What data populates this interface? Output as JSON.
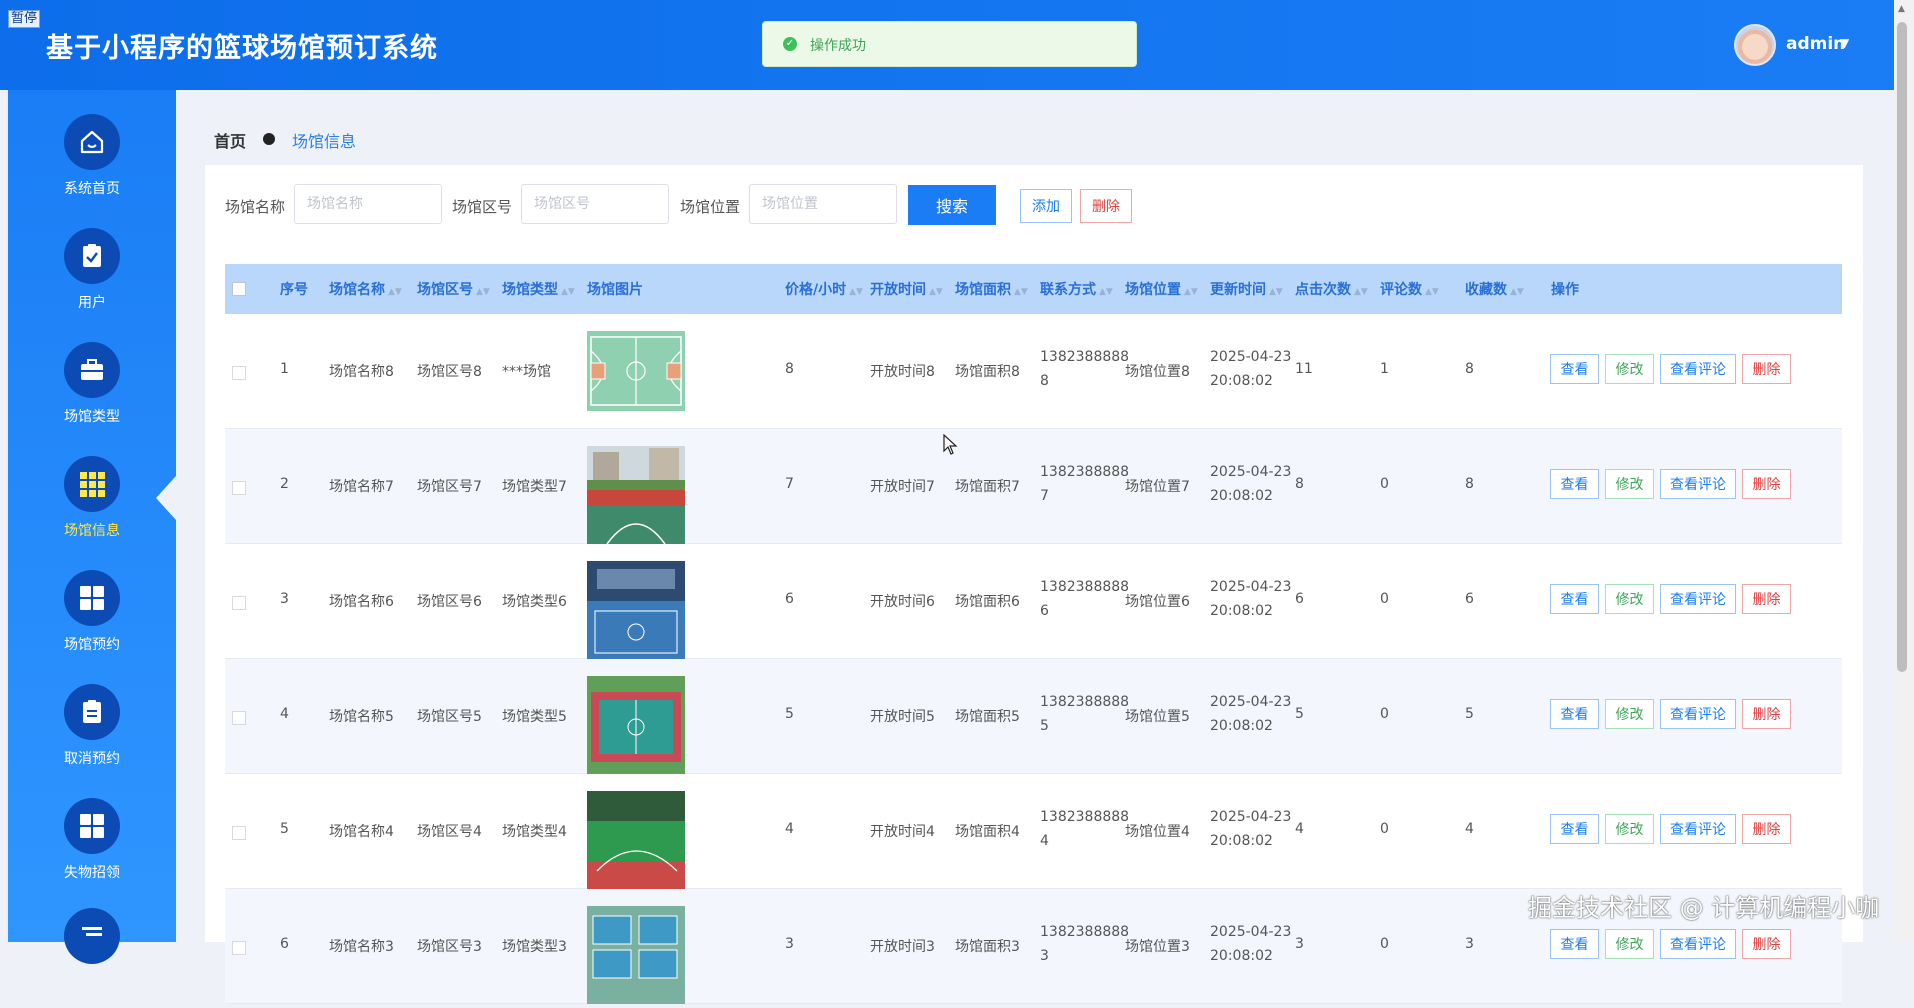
{
  "pause_tag": "暂停",
  "header": {
    "title": "基于小程序的篮球场馆预订系统",
    "user": "admin",
    "caret": "▼"
  },
  "toast": {
    "text": "操作成功",
    "icon": "✓"
  },
  "sidebar": {
    "items": [
      {
        "label": "系统首页",
        "icon": "home-icon"
      },
      {
        "label": "用户",
        "icon": "clipboard-check-icon"
      },
      {
        "label": "场馆类型",
        "icon": "briefcase-icon"
      },
      {
        "label": "场馆信息",
        "icon": "grid-nine-icon",
        "active": true
      },
      {
        "label": "场馆预约",
        "icon": "grid-four-icon"
      },
      {
        "label": "取消预约",
        "icon": "clipboard-icon"
      },
      {
        "label": "失物招领",
        "icon": "grid-four-icon"
      }
    ]
  },
  "breadcrumb": {
    "home": "首页",
    "current": "场馆信息"
  },
  "search": {
    "name_label": "场馆名称",
    "name_placeholder": "场馆名称",
    "zone_label": "场馆区号",
    "zone_placeholder": "场馆区号",
    "location_label": "场馆位置",
    "location_placeholder": "场馆位置",
    "search_button": "搜索",
    "add_button": "添加",
    "delete_button": "删除"
  },
  "table": {
    "columns": [
      "序号",
      "场馆名称",
      "场馆区号",
      "场馆类型",
      "场馆图片",
      "价格/小时",
      "开放时间",
      "场馆面积",
      "联系方式",
      "场馆位置",
      "更新时间",
      "点击次数",
      "评论数",
      "收藏数",
      "操作"
    ],
    "actions": {
      "view": "查看",
      "edit": "修改",
      "comments": "查看评论",
      "delete": "删除"
    },
    "rows": [
      {
        "no": "1",
        "name": "场馆名称8",
        "zone": "场馆区号8",
        "type": "***场馆",
        "price": "8",
        "open": "开放时间8",
        "area": "场馆面积8",
        "phone1": "1382388888",
        "phone2": "8",
        "location": "场馆位置8",
        "date": "2025-04-23",
        "time": "20:08:02",
        "clicks": "11",
        "comments": "1",
        "favorites": "8",
        "image": "court-diagram"
      },
      {
        "no": "2",
        "name": "场馆名称7",
        "zone": "场馆区号7",
        "type": "场馆类型7",
        "price": "7",
        "open": "开放时间7",
        "area": "场馆面积7",
        "phone1": "1382388888",
        "phone2": "7",
        "location": "场馆位置7",
        "date": "2025-04-23",
        "time": "20:08:02",
        "clicks": "8",
        "comments": "0",
        "favorites": "8",
        "image": "outdoor-red-court"
      },
      {
        "no": "3",
        "name": "场馆名称6",
        "zone": "场馆区号6",
        "type": "场馆类型6",
        "price": "6",
        "open": "开放时间6",
        "area": "场馆面积6",
        "phone1": "1382388888",
        "phone2": "6",
        "location": "场馆位置6",
        "date": "2025-04-23",
        "time": "20:08:02",
        "clicks": "6",
        "comments": "0",
        "favorites": "6",
        "image": "indoor-blue-court"
      },
      {
        "no": "4",
        "name": "场馆名称5",
        "zone": "场馆区号5",
        "type": "场馆类型5",
        "price": "5",
        "open": "开放时间5",
        "area": "场馆面积5",
        "phone1": "1382388888",
        "phone2": "5",
        "location": "场馆位置5",
        "date": "2025-04-23",
        "time": "20:08:02",
        "clicks": "5",
        "comments": "0",
        "favorites": "5",
        "image": "teal-red-court"
      },
      {
        "no": "5",
        "name": "场馆名称4",
        "zone": "场馆区号4",
        "type": "场馆类型4",
        "price": "4",
        "open": "开放时间4",
        "area": "场馆面积4",
        "phone1": "1382388888",
        "phone2": "4",
        "location": "场馆位置4",
        "date": "2025-04-23",
        "time": "20:08:02",
        "clicks": "4",
        "comments": "0",
        "favorites": "4",
        "image": "green-court"
      },
      {
        "no": "6",
        "name": "场馆名称3",
        "zone": "场馆区号3",
        "type": "场馆类型3",
        "price": "3",
        "open": "开放时间3",
        "area": "场馆面积3",
        "phone1": "1382388888",
        "phone2": "3",
        "location": "场馆位置3",
        "date": "2025-04-23",
        "time": "20:08:02",
        "clicks": "3",
        "comments": "0",
        "favorites": "3",
        "image": "aerial-courts"
      }
    ]
  },
  "watermark": "掘金技术社区 @ 计算机编程小咖",
  "colors": {
    "primary": "#1a7df5",
    "header_bg": "#0d6dea",
    "sidebar_circle": "#0d4bb4",
    "active_label": "#ffe94d",
    "table_header_bg": "#b9d7fb",
    "success": "#3fa556",
    "danger": "#e04040"
  }
}
